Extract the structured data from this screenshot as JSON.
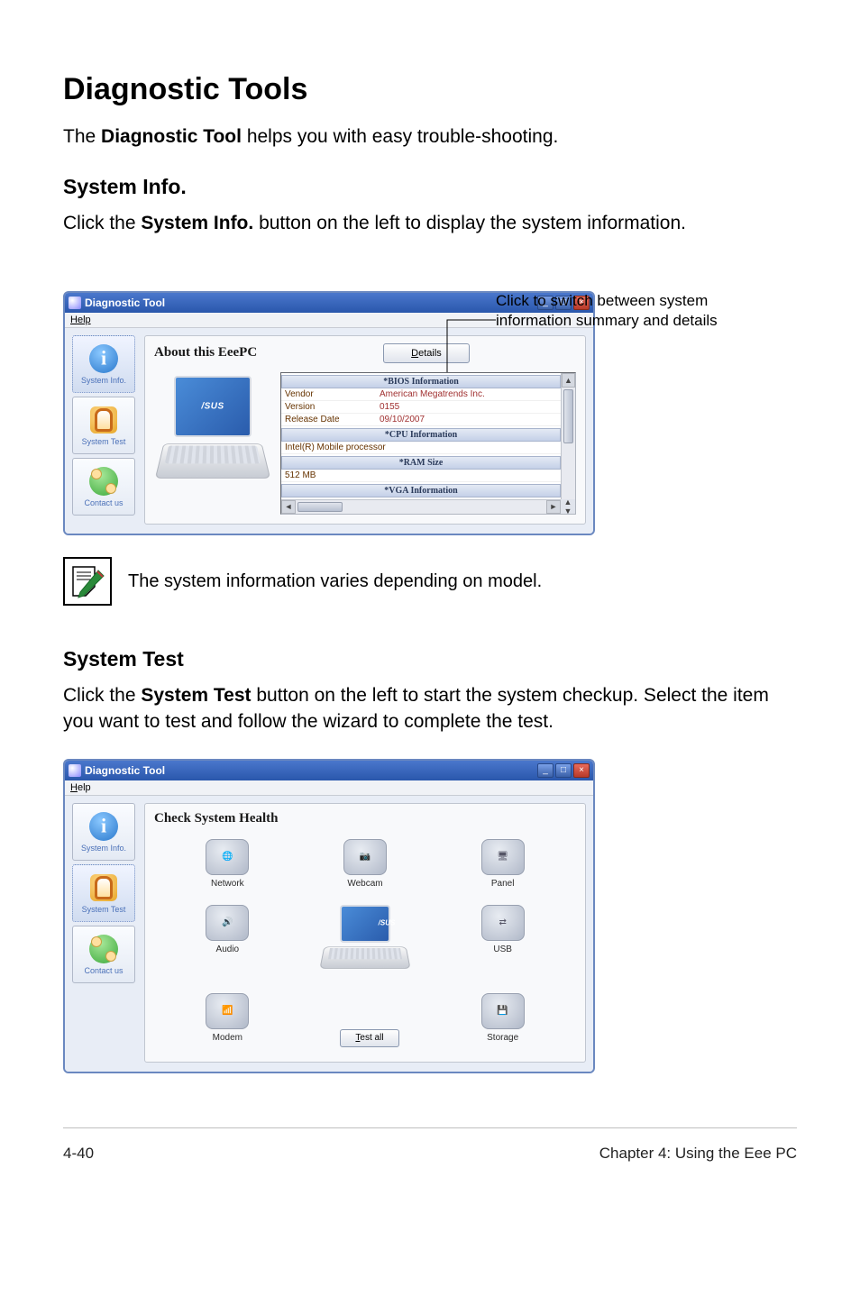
{
  "title": "Diagnostic Tools",
  "intro": {
    "pre": "The ",
    "b": "Diagnostic Tool",
    "post": " helps you with easy trouble-shooting."
  },
  "sysinfo": {
    "heading": "System Info.",
    "text_pre": "Click the ",
    "text_b": "System Info.",
    "text_post": " button on the left to display the system information.",
    "annotation": "Click to switch between system information summary and details"
  },
  "window1": {
    "title": "Diagnostic Tool",
    "help": "Help",
    "pane_title": "About this EeePC",
    "details_btn": "Details",
    "sidebar": [
      "System Info.",
      "System Test",
      "Contact us"
    ],
    "laptop_logo": "/SUS",
    "groups": [
      {
        "header": "*BIOS Information",
        "rows": [
          {
            "k": "Vendor",
            "v": "American Megatrends Inc."
          },
          {
            "k": "Version",
            "v": "0155"
          },
          {
            "k": "Release Date",
            "v": "09/10/2007"
          }
        ]
      },
      {
        "header": "*CPU Information",
        "rows": [
          {
            "k": "Intel(R) Mobile processor",
            "v": ""
          }
        ]
      },
      {
        "header": "*RAM Size",
        "rows": [
          {
            "k": "512 MB",
            "v": ""
          }
        ]
      },
      {
        "header": "*VGA Information",
        "rows": []
      }
    ]
  },
  "note": "The system information varies depending on model.",
  "systest": {
    "heading": "System Test",
    "text_pre": "Click the ",
    "text_b": "System Test",
    "text_post": " button on the left to start the system checkup. Select the item you want to test and follow the wizard to complete the test."
  },
  "window2": {
    "title": "Diagnostic Tool",
    "help": "Help",
    "pane_title": "Check System Health",
    "testall_btn": "Test all",
    "laptop_logo": "/SUS",
    "items": [
      "Network",
      "Webcam",
      "Panel",
      "Audio",
      "",
      "USB",
      "Modem",
      "",
      "Storage"
    ]
  },
  "footer": {
    "left": "4-40",
    "right": "Chapter 4: Using the Eee PC"
  }
}
